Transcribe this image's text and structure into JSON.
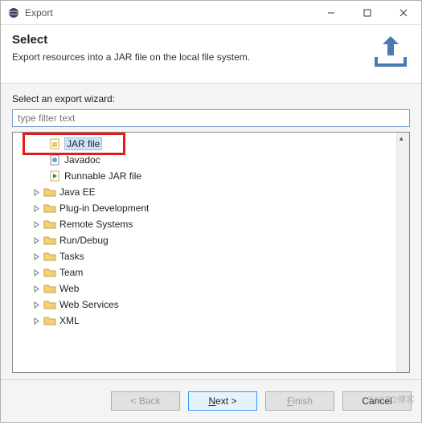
{
  "titlebar": {
    "title": "Export"
  },
  "header": {
    "title": "Select",
    "description": "Export resources into a JAR file on the local file system."
  },
  "body": {
    "wizard_label": "Select an export wizard:",
    "filter_placeholder": "type filter text"
  },
  "tree": {
    "item_jarfile": "JAR file",
    "item_javadoc": "Javadoc",
    "item_runnable": "Runnable JAR file",
    "folder_javaee": "Java EE",
    "folder_plugin": "Plug-in Development",
    "folder_remote": "Remote Systems",
    "folder_rundebug": "Run/Debug",
    "folder_tasks": "Tasks",
    "folder_team": "Team",
    "folder_web": "Web",
    "folder_webservices": "Web Services",
    "folder_xml": "XML"
  },
  "footer": {
    "back": "< Back",
    "next_pre": "N",
    "next_post": "ext >",
    "finish_pre": "F",
    "finish_post": "inish",
    "cancel": "Cancel"
  },
  "watermark": "51CTO博客"
}
